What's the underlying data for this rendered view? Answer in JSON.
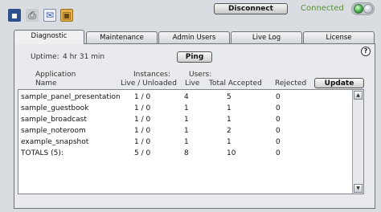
{
  "toolbar": {
    "icons": [
      "save-icon",
      "print-icon",
      "mail-icon",
      "lock-icon"
    ],
    "disconnect_label": "Disconnect",
    "status_text": "Connected",
    "status_color": "#5a8e3c"
  },
  "tabs": [
    {
      "label": "Diagnostic",
      "active": true
    },
    {
      "label": "Maintenance"
    },
    {
      "label": "Admin Users"
    },
    {
      "label": "Live Log"
    },
    {
      "label": "License"
    }
  ],
  "diagnostic": {
    "uptime_label": "Uptime:",
    "uptime_value": "4 hr 31 min",
    "ping_label": "Ping",
    "update_label": "Update",
    "help_glyph": "?",
    "headers": {
      "app_line1": "Application",
      "app_line2": "Name",
      "instances_line1": "Instances:",
      "instances_line2": "Live / Unloaded",
      "users_line1": "Users:",
      "live": "Live",
      "total": "Total Accepted",
      "rejected": "Rejected"
    },
    "rows": [
      {
        "name": "sample_panel_presentation",
        "instances": "1 / 0",
        "live": "4",
        "total": "5",
        "rejected": "0"
      },
      {
        "name": "sample_guestbook",
        "instances": "1 / 0",
        "live": "1",
        "total": "1",
        "rejected": "0"
      },
      {
        "name": "sample_broadcast",
        "instances": "1 / 0",
        "live": "1",
        "total": "1",
        "rejected": "0"
      },
      {
        "name": "sample_noteroom",
        "instances": "1 / 0",
        "live": "1",
        "total": "2",
        "rejected": "0"
      },
      {
        "name": "example_snapshot",
        "instances": "1 / 0",
        "live": "1",
        "total": "1",
        "rejected": "0"
      },
      {
        "name": "TOTALS (5):",
        "instances": "5 / 0",
        "live": "8",
        "total": "10",
        "rejected": "0"
      }
    ]
  }
}
